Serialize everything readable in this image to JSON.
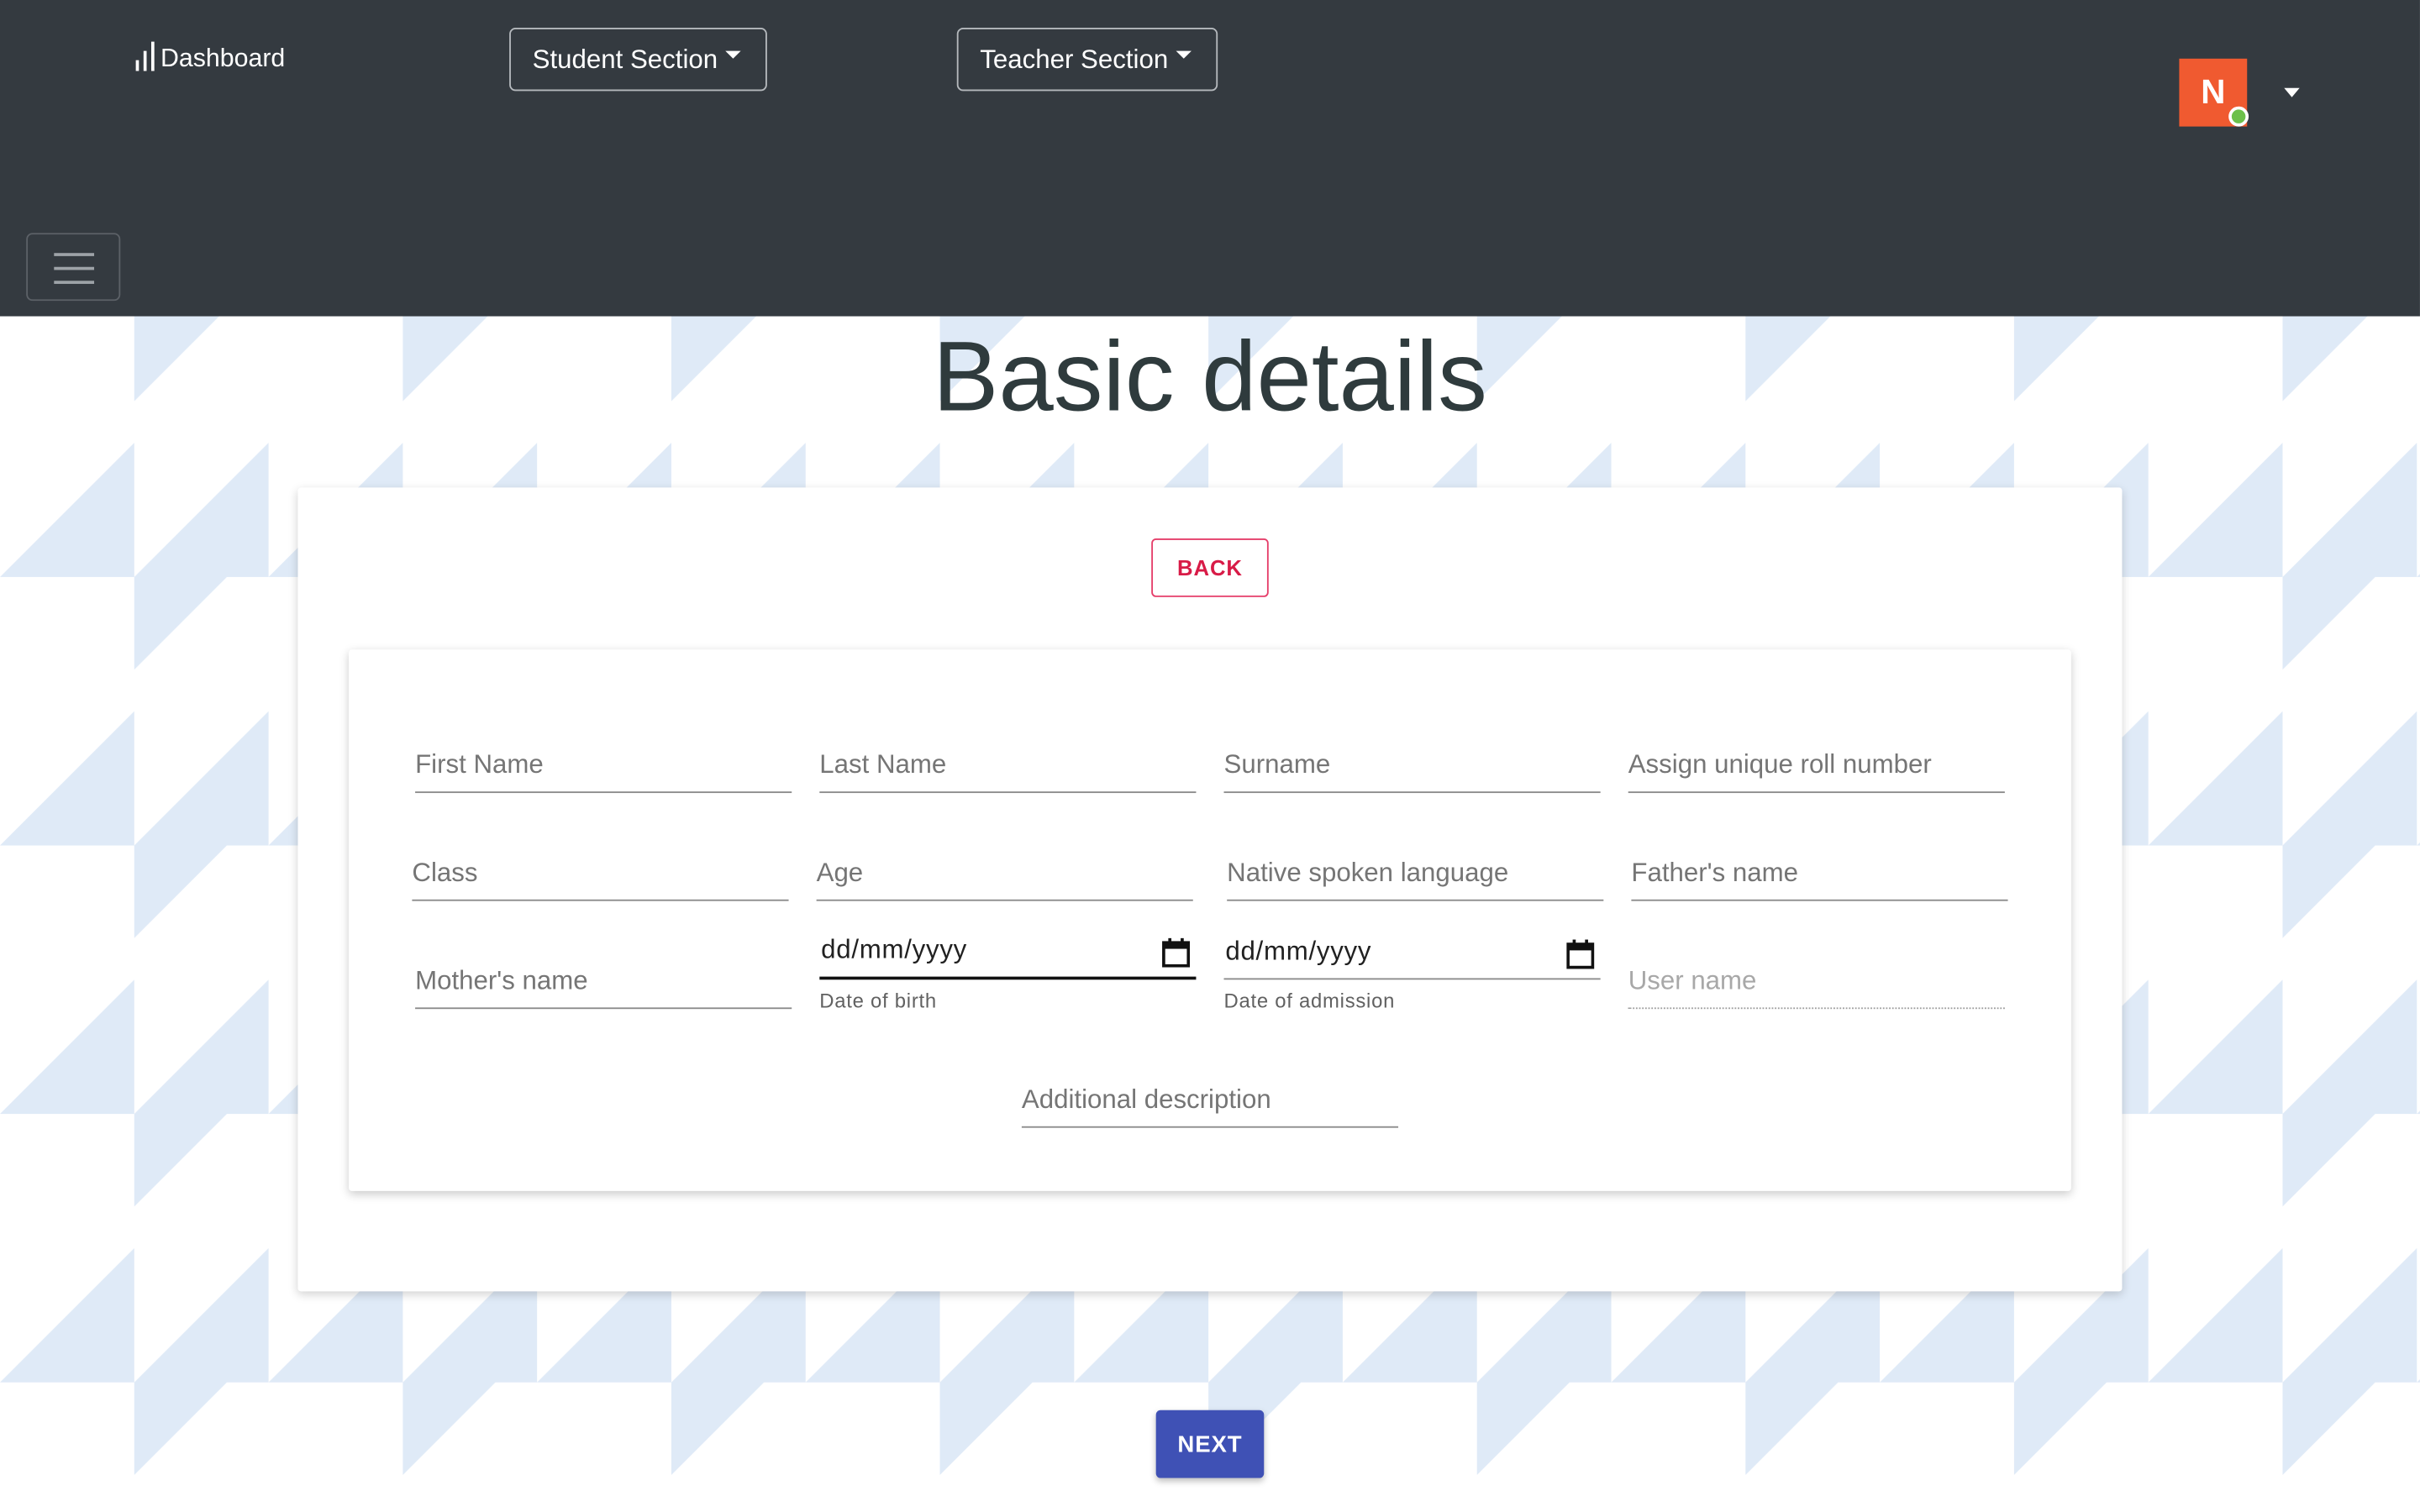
{
  "navbar": {
    "brand_label": "Dashboard",
    "student_section_label": "Student Section",
    "teacher_section_label": "Teacher Section",
    "avatar_initial": "N",
    "background_color": "#343a40"
  },
  "page": {
    "title": "Basic details",
    "pattern_color": "#dfeaf7"
  },
  "form": {
    "back_label": "BACK",
    "next_label": "NEXT",
    "fields": {
      "first_name": "First Name",
      "last_name": "Last Name",
      "surname": "Surname",
      "roll_number": "Assign unique roll number",
      "class": "Class",
      "age": "Age",
      "native_language": "Native spoken language",
      "fathers_name": "Father's name",
      "mothers_name": "Mother's name",
      "dob_value": "dd/mm/yyyy",
      "dob_helper": "Date of birth",
      "doa_value": "dd/mm/yyyy",
      "doa_helper": "Date of admission",
      "user_name": "User name",
      "additional_description": "Additional description"
    }
  },
  "colors": {
    "accent_back": "#d81b47",
    "primary_next": "#3f51b5",
    "avatar_bg": "#f05a30",
    "online": "#6cc04a"
  }
}
